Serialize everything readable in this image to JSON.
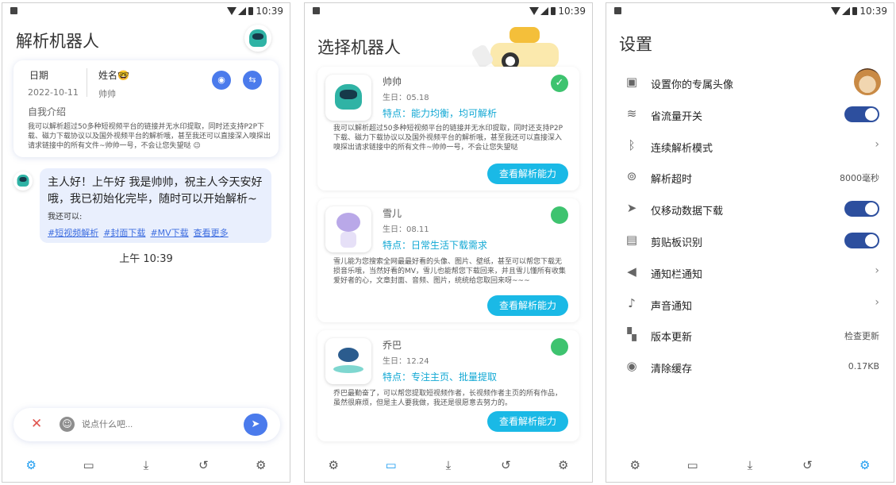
{
  "status": {
    "time": "10:39"
  },
  "s1": {
    "title": "解析机器人",
    "date_label": "日期",
    "date_value": "2022-10-11",
    "name_label": "姓名🤓",
    "name_value": "帅帅",
    "intro_label": "自我介绍",
    "intro_text": "我可以解析超过50多种短视频平台的链接并无水印提取，同时还支持P2P下载、磁力下载协议以及国外视频平台的解析哦，甚至我还可以直接深入嗅探出请求链接中的所有文件~帅帅一号，不会让您失望哒 😉",
    "message": "主人好！上午好 我是帅帅，祝主人今天安好哦，我已初始化完毕，随时可以开始解析~",
    "also": "我还可以:",
    "tags": [
      "#短视频解析",
      "#封面下载",
      "#MV下载",
      "查看更多"
    ],
    "timestamp": "上午 10:39",
    "input_placeholder": "说点什么吧..."
  },
  "s2": {
    "title": "选择机器人",
    "button": "查看解析能力",
    "robots": [
      {
        "name": "帅帅",
        "birthday": "生日：05.18",
        "feature": "特点：能力均衡，均可解析",
        "selected": true,
        "desc": "我可以解析超过50多种短视频平台的链接并无水印提取，同时还支持P2P下载、磁力下载协议以及国外视频平台的解析哦，甚至我还可以直接深入嗅探出请求链接中的所有文件~帅帅一号，不会让您失望哒"
      },
      {
        "name": "雪儿",
        "birthday": "生日：08.11",
        "feature": "特点：日常生活下载需求",
        "selected": false,
        "desc": "雪儿能为您搜索全网最最好看的头像、图片、壁纸，甚至可以帮您下载无损音乐哦，当然好看的MV，雪儿也能帮您下载回来，并且雪儿懂所有收集爱好者的心，文章封面、音频、图片，统统给您取回来呀~~~"
      },
      {
        "name": "乔巴",
        "birthday": "生日：12.24",
        "feature": "特点：专注主页、批量提取",
        "selected": false,
        "desc": "乔巴最勤奋了，可以帮您提取短视频作者，长视频作者主页的所有作品，虽然很麻烦，但是主人要我做，我还是很愿意去努力的。"
      }
    ]
  },
  "s3": {
    "title": "设置",
    "rows": [
      {
        "icon": "image-icon",
        "label": "设置你的专属头像",
        "type": "avatar"
      },
      {
        "icon": "wifi-icon",
        "label": "省流量开关",
        "type": "toggle",
        "on": true
      },
      {
        "icon": "bluetooth-icon",
        "label": "连续解析模式",
        "type": "chevron"
      },
      {
        "icon": "antenna-icon",
        "label": "解析超时",
        "type": "value",
        "value": "8000毫秒"
      },
      {
        "icon": "send-icon",
        "label": "仅移动数据下载",
        "type": "toggle",
        "on": true
      },
      {
        "icon": "keyboard-icon",
        "label": "剪贴板识别",
        "type": "toggle",
        "on": true
      },
      {
        "icon": "speaker-icon",
        "label": "通知栏通知",
        "type": "chevron"
      },
      {
        "icon": "mic-icon",
        "label": "声音通知",
        "type": "chevron"
      },
      {
        "icon": "widgets-icon",
        "label": "版本更新",
        "type": "value",
        "value": "检查更新"
      },
      {
        "icon": "eye-icon",
        "label": "清除缓存",
        "type": "value",
        "value": "0.17KB"
      }
    ]
  },
  "nav": [
    "robot-icon",
    "chat-icon",
    "download-icon",
    "history-icon",
    "settings-icon"
  ],
  "colors": {
    "accent": "#1ab9e6",
    "toggle": "#2d4f9e",
    "bubble": "#e9effd",
    "check": "#3ec36f"
  }
}
